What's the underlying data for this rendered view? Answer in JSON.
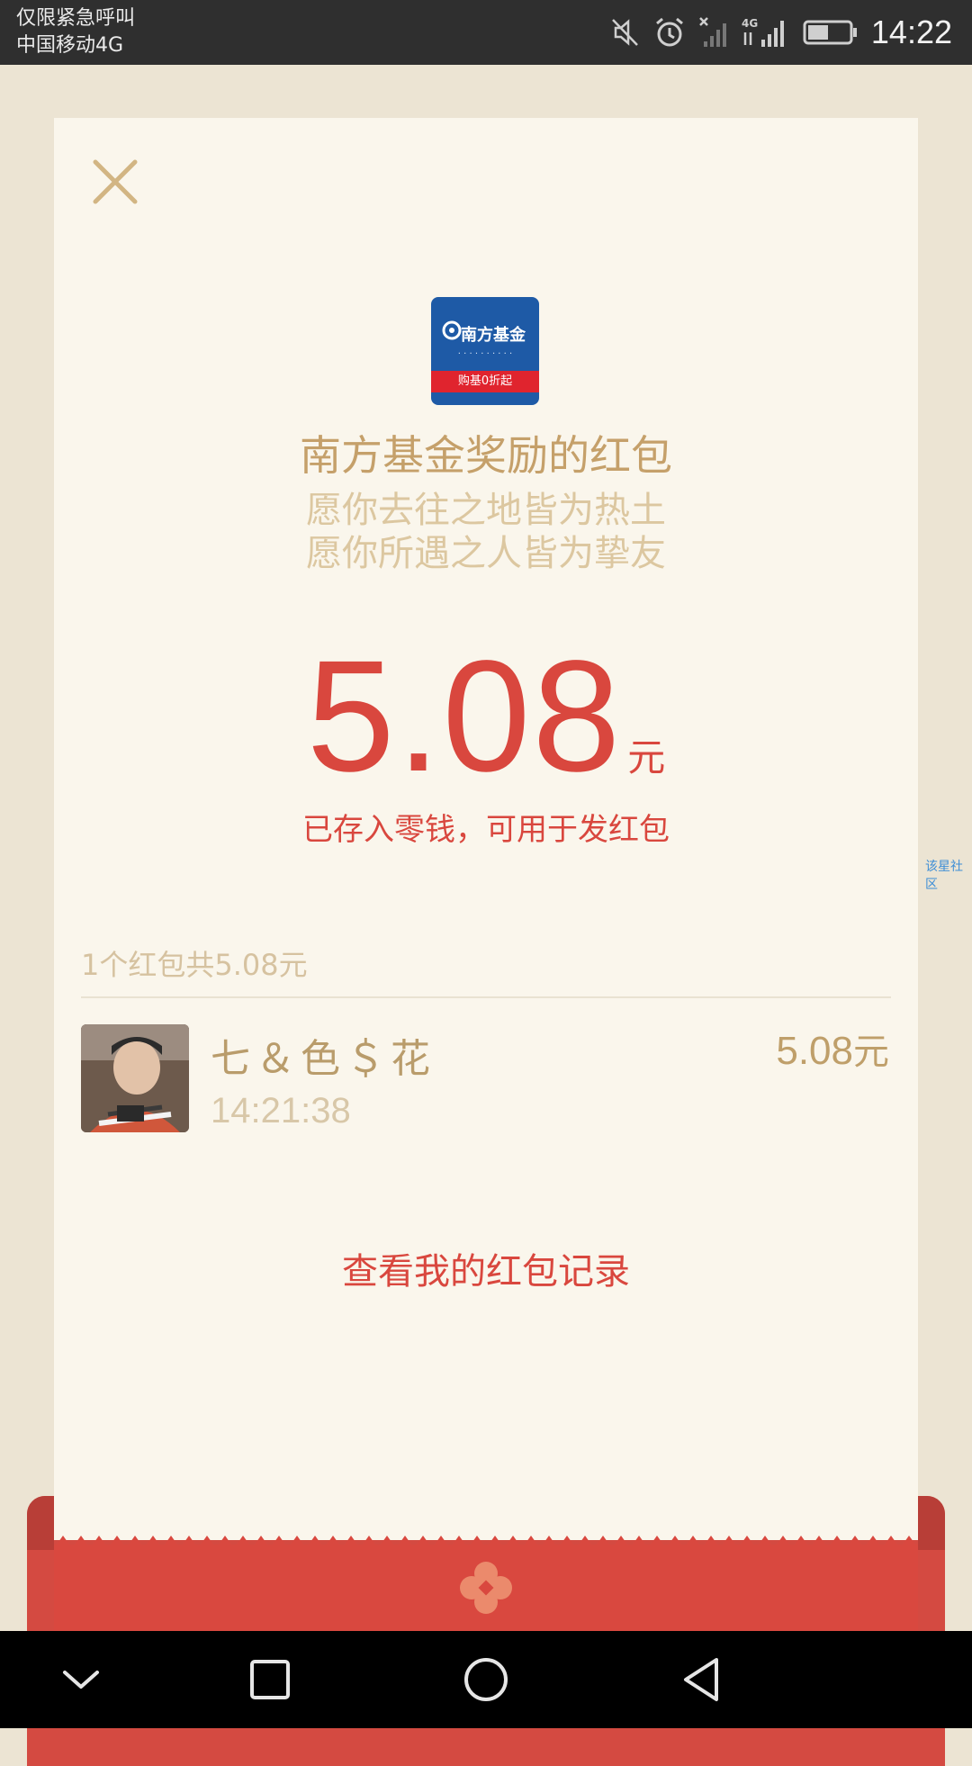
{
  "status_bar": {
    "line1": "仅限紧急呼叫",
    "line2": "中国移动4G",
    "time": "14:22",
    "icons": [
      "mute-icon",
      "alarm-icon",
      "no-signal-icon",
      "4g-signal-icon",
      "battery-icon"
    ]
  },
  "card": {
    "logo": {
      "brand": "南方基金",
      "ribbon": "购基0折起"
    },
    "title": "南方基金奖励的红包",
    "blessing_line1": "愿你去往之地皆为热土",
    "blessing_line2": "愿你所遇之人皆为挚友",
    "amount": "5.08",
    "amount_unit": "元",
    "saved_note": "已存入零钱，可用于发红包",
    "side_link": "该星社区",
    "summary": "1个红包共5.08元",
    "record": {
      "name": "七＆色＄花",
      "time": "14:21:38",
      "amount": "5.08",
      "amount_unit": "元"
    },
    "records_link": "查看我的红包记录"
  },
  "colors": {
    "accent_red": "#d9473e",
    "gold": "#c5a06a",
    "card_bg": "#faf6ec",
    "page_bg": "#ece4d3"
  },
  "nav_bar": {
    "icons": [
      "chevron-down-icon",
      "square-recent-icon",
      "circle-home-icon",
      "triangle-back-icon"
    ]
  }
}
